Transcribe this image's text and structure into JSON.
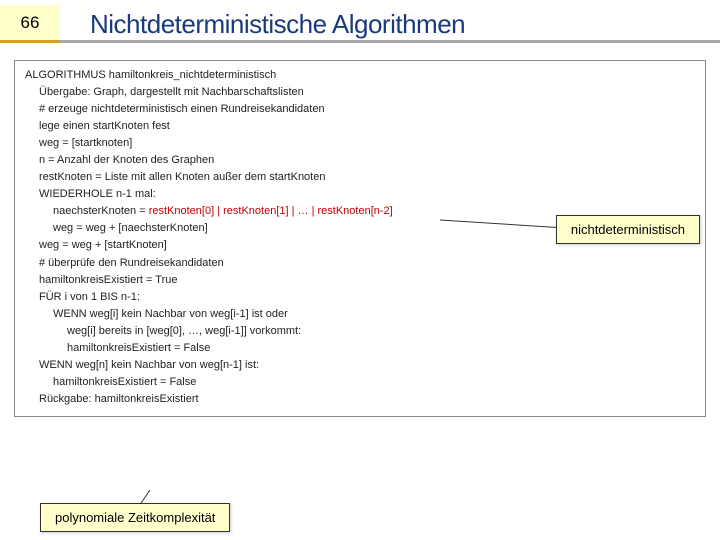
{
  "header": {
    "slide_number": "66",
    "title": "Nichtdeterministische Algorithmen"
  },
  "algo": {
    "l0": "ALGORITHMUS hamiltonkreis_nichtdeterministisch",
    "l1": "Übergabe: Graph, dargestellt mit Nachbarschaftslisten",
    "l2": "# erzeuge nichtdeterministisch einen Rundreisekandidaten",
    "l3": "lege einen startKnoten fest",
    "l4": "weg = [startknoten]",
    "l5": "n = Anzahl der Knoten des Graphen",
    "l6": "restKnoten = Liste mit allen Knoten außer dem startKnoten",
    "l7": "WIEDERHOLE n-1 mal:",
    "l8a": "naechsterKnoten = ",
    "l8b": "restKnoten[0] | restKnoten[1] | … | restKnoten[n-2]",
    "l9": "weg = weg + [naechsterKnoten]",
    "l10": "weg = weg + [startKnoten]",
    "l11": "# überprüfe den Rundreisekandidaten",
    "l12": "hamiltonkreisExistiert = True",
    "l13": "FÜR i von 1 BIS n-1:",
    "l14": "WENN weg[i] kein Nachbar von weg[i-1] ist oder",
    "l15": "weg[i] bereits in [weg[0], …, weg[i-1]] vorkommt:",
    "l16": "hamiltonkreisExistiert = False",
    "l17": "WENN weg[n] kein Nachbar von weg[n-1] ist:",
    "l18": "hamiltonkreisExistiert = False",
    "l19": "Rückgabe: hamiltonkreisExistiert"
  },
  "callouts": {
    "right": "nichtdeterministisch",
    "bottom": "polynomiale Zeitkomplexität"
  }
}
